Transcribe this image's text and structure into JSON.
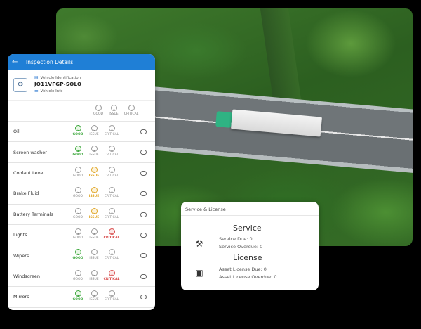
{
  "inspection": {
    "title": "Inspection Details",
    "vehicle_label": "Vehicle Identification",
    "plate": "JQ11VFGP-SOLO",
    "vehicle_info": "Vehicle Info",
    "options": [
      "GOOD",
      "ISSUE",
      "CRITICAL"
    ],
    "items": [
      {
        "name": "Oil",
        "status": "GOOD"
      },
      {
        "name": "Screen washer",
        "status": "GOOD"
      },
      {
        "name": "Coolant Level",
        "status": "ISSUE"
      },
      {
        "name": "Brake Fluid",
        "status": "ISSUE"
      },
      {
        "name": "Battery Terminals",
        "status": "ISSUE"
      },
      {
        "name": "Lights",
        "status": "CRITICAL"
      },
      {
        "name": "Wipers",
        "status": "GOOD"
      },
      {
        "name": "Windscreen",
        "status": "CRITICAL"
      },
      {
        "name": "Mirrors",
        "status": "GOOD"
      }
    ]
  },
  "service": {
    "header": "Service & License",
    "service_title": "Service",
    "service_due": "Service Due: 0",
    "service_overdue": "Service Overdue: 0",
    "license_title": "License",
    "license_due": "Asset License Due: 0",
    "license_overdue": "Asset License Overdue: 0"
  },
  "colors": {
    "header_blue": "#1f7fd6",
    "good": "#3aa63a",
    "issue": "#e0a72a",
    "critical": "#d64343"
  }
}
